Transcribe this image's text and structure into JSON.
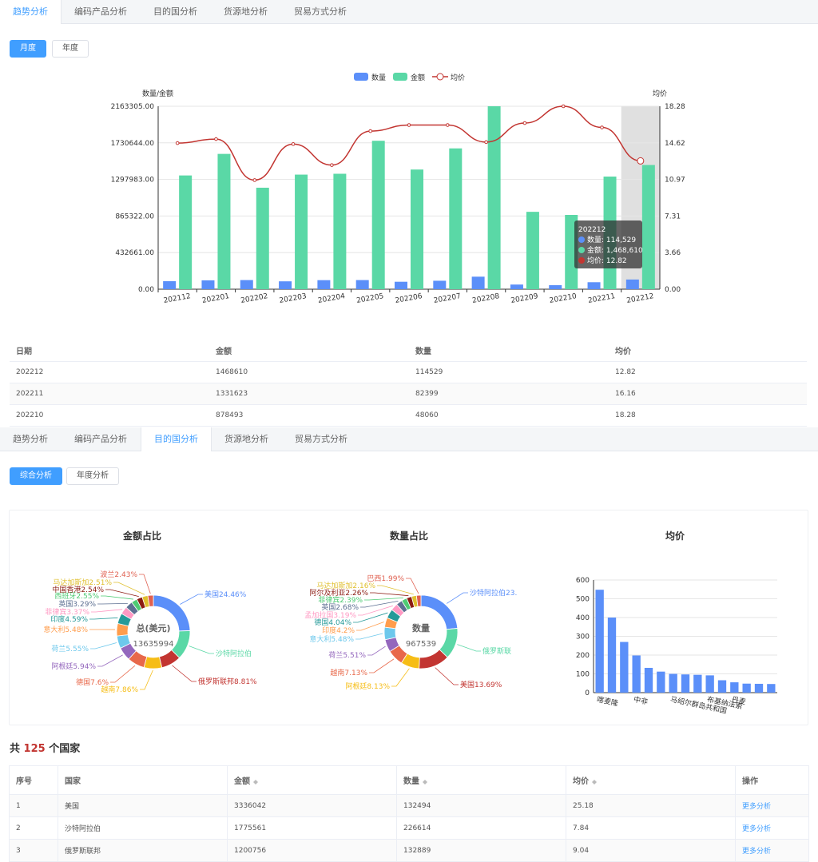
{
  "tabs": [
    "趋势分析",
    "编码产品分析",
    "目的国分析",
    "货源地分析",
    "贸易方式分析"
  ],
  "section1": {
    "btn_month": "月度",
    "btn_year": "年度"
  },
  "section2": {
    "btn_overall": "综合分析",
    "btn_year": "年度分析"
  },
  "colors": {
    "qty": "#5b8ff9",
    "amount": "#5ad8a6",
    "price": "#c23531",
    "accent": "#409eff",
    "count": "#c23531"
  },
  "chart_data": [
    {
      "type": "bar",
      "legend": [
        "数量",
        "金额",
        "均价"
      ],
      "ylabel": "数量/金额",
      "y2label": "均价",
      "yticks": [
        "0.00",
        "432661.00",
        "865322.00",
        "1297983.00",
        "1730644.00",
        "2163305.00"
      ],
      "y2ticks": [
        "0.00",
        "3.66",
        "7.31",
        "10.97",
        "14.62",
        "18.28"
      ],
      "ylim": [
        0,
        2163305
      ],
      "y2lim": [
        0,
        18.28
      ],
      "categories": [
        "202112",
        "202201",
        "202202",
        "202203",
        "202204",
        "202205",
        "202206",
        "202207",
        "202208",
        "202209",
        "202210",
        "202211",
        "202212"
      ],
      "series": [
        {
          "name": "数量",
          "values": [
            95000,
            105000,
            108000,
            93000,
            107000,
            108000,
            88000,
            100000,
            148000,
            55000,
            48060,
            82399,
            114529
          ]
        },
        {
          "name": "金额",
          "values": [
            1345000,
            1600000,
            1200000,
            1355000,
            1365000,
            1755000,
            1415000,
            1665000,
            2163305,
            915000,
            878493,
            1331623,
            1468610
          ]
        },
        {
          "name": "均价",
          "values": [
            14.6,
            15.0,
            10.9,
            14.5,
            12.4,
            15.8,
            16.4,
            16.4,
            14.7,
            16.6,
            18.28,
            16.16,
            12.82
          ]
        }
      ],
      "tooltip": {
        "title": "202212",
        "lines": [
          "数量: 114,529",
          "金额: 1,468,610",
          "均价: 12.82"
        ]
      }
    },
    {
      "type": "pie",
      "title": "金额占比",
      "center_label": "总(美元)",
      "center_value": "13635994",
      "labels": [
        {
          "text": "美国24.46%",
          "pct": 24.46,
          "color": "#5b8ff9"
        },
        {
          "text": "沙特阿拉伯",
          "pct": 13.0,
          "color": "#5ad8a6"
        },
        {
          "text": "俄罗斯联邦8.81%",
          "pct": 8.81,
          "color": "#c23531"
        },
        {
          "text": "越南7.86%",
          "pct": 7.86,
          "color": "#f6bd16"
        },
        {
          "text": "德国7.6%",
          "pct": 7.6,
          "color": "#e8684a"
        },
        {
          "text": "阿根廷5.94%",
          "pct": 5.94,
          "color": "#9467bd"
        },
        {
          "text": "荷兰5.55%",
          "pct": 5.55,
          "color": "#6dc8ec"
        },
        {
          "text": "意大利5.48%",
          "pct": 5.48,
          "color": "#ff9d4d"
        },
        {
          "text": "印度4.59%",
          "pct": 4.59,
          "color": "#269a99"
        },
        {
          "text": "菲律宾3.37%",
          "pct": 3.37,
          "color": "#ff99c3"
        },
        {
          "text": "英国3.29%",
          "pct": 3.29,
          "color": "#5d7092"
        },
        {
          "text": "西班牙2.55%",
          "pct": 2.55,
          "color": "#4ecb73"
        },
        {
          "text": "中国香港2.54%",
          "pct": 2.54,
          "color": "#8c1c13"
        },
        {
          "text": "马达加斯加2.51%",
          "pct": 2.51,
          "color": "#e0c030"
        },
        {
          "text": "波兰2.43%",
          "pct": 2.43,
          "color": "#e06050"
        }
      ]
    },
    {
      "type": "pie",
      "title": "数量占比",
      "center_label": "数量",
      "center_value": "967539",
      "labels": [
        {
          "text": "沙特阿拉伯23.",
          "pct": 23.42,
          "color": "#5b8ff9"
        },
        {
          "text": "俄罗斯联",
          "pct": 13.73,
          "color": "#5ad8a6"
        },
        {
          "text": "美国13.69%",
          "pct": 13.69,
          "color": "#c23531"
        },
        {
          "text": "阿根廷8.13%",
          "pct": 8.13,
          "color": "#f6bd16"
        },
        {
          "text": "越南7.13%",
          "pct": 7.13,
          "color": "#e8684a"
        },
        {
          "text": "荷兰5.51%",
          "pct": 5.51,
          "color": "#9467bd"
        },
        {
          "text": "意大利5.48%",
          "pct": 5.48,
          "color": "#6dc8ec"
        },
        {
          "text": "印度4.2%",
          "pct": 4.2,
          "color": "#ff9d4d"
        },
        {
          "text": "德国4.04%",
          "pct": 4.04,
          "color": "#269a99"
        },
        {
          "text": "孟加拉国3.19%",
          "pct": 3.19,
          "color": "#ff99c3"
        },
        {
          "text": "英国2.68%",
          "pct": 2.68,
          "color": "#5d7092"
        },
        {
          "text": "菲律宾2.39%",
          "pct": 2.39,
          "color": "#4ecb73"
        },
        {
          "text": "阿尔及利亚2.26%",
          "pct": 2.26,
          "color": "#8c1c13"
        },
        {
          "text": "马达加斯加2.16%",
          "pct": 2.16,
          "color": "#e0c030"
        },
        {
          "text": "巴西1.99%",
          "pct": 1.99,
          "color": "#e06050"
        }
      ]
    },
    {
      "type": "bar",
      "title": "均价",
      "yticks": [
        "0",
        "100",
        "200",
        "300",
        "400",
        "500",
        "600"
      ],
      "ylim": [
        0,
        600
      ],
      "x_labels_shown": [
        "喀麦隆",
        "中非",
        "马绍尔群岛共和国",
        "布基纳法索",
        "丹麦"
      ],
      "values": [
        548,
        400,
        270,
        198,
        132,
        112,
        100,
        97,
        95,
        92,
        66,
        55,
        48,
        47,
        46
      ]
    }
  ],
  "table1": {
    "headers": [
      "日期",
      "金额",
      "数量",
      "均价"
    ],
    "rows": [
      [
        "202212",
        "1468610",
        "114529",
        "12.82"
      ],
      [
        "202211",
        "1331623",
        "82399",
        "16.16"
      ],
      [
        "202210",
        "878493",
        "48060",
        "18.28"
      ]
    ]
  },
  "summary": {
    "prefix": "共",
    "count": "125",
    "suffix": "个国家"
  },
  "table2": {
    "headers": [
      "序号",
      "国家",
      "金额",
      "数量",
      "均价",
      "操作"
    ],
    "rows": [
      [
        "1",
        "美国",
        "3336042",
        "132494",
        "25.18",
        "更多分析"
      ],
      [
        "2",
        "沙特阿拉伯",
        "1775561",
        "226614",
        "7.84",
        "更多分析"
      ],
      [
        "3",
        "俄罗斯联邦",
        "1200756",
        "132889",
        "9.04",
        "更多分析"
      ]
    ]
  }
}
